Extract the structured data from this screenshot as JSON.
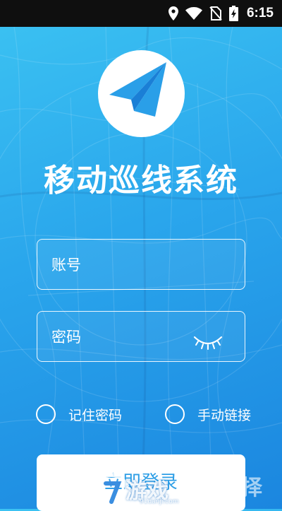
{
  "status_bar": {
    "time": "6:15",
    "icons": [
      "location-icon",
      "wifi-icon",
      "no-sim-icon",
      "battery-charging-icon"
    ]
  },
  "app": {
    "title": "移动巡线系统",
    "logo_icon": "paper-plane-icon",
    "brand_color": "#2a9fe8"
  },
  "form": {
    "username": {
      "value": "",
      "placeholder": "账号"
    },
    "password": {
      "value": "",
      "placeholder": "密码",
      "toggle_icon": "eye-closed-icon"
    },
    "options": [
      {
        "label": "记住密码",
        "checked": false
      },
      {
        "label": "手动链接",
        "checked": false
      }
    ],
    "login_label": "立即登录"
  },
  "watermark": {
    "text": "游戏",
    "sub": "91danji.com",
    "right_text": "择"
  }
}
